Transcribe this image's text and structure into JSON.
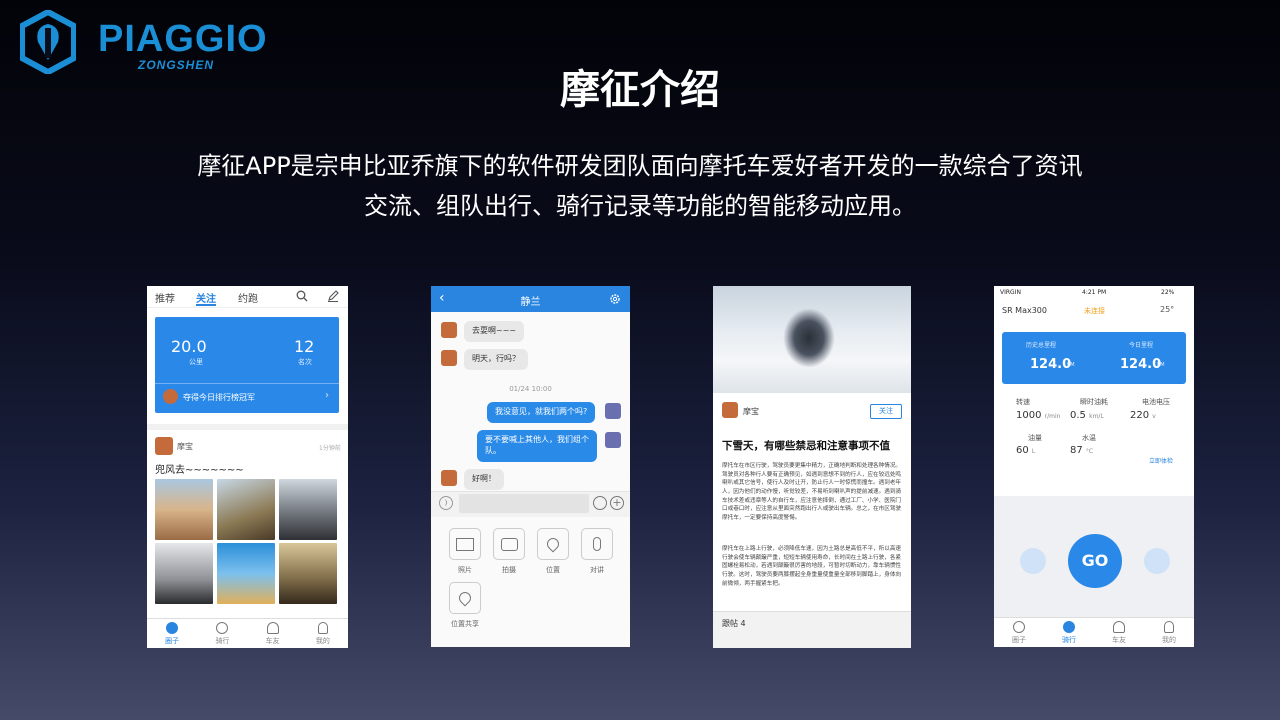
{
  "brand": {
    "name": "PIAGGIO",
    "sub": "ZONGSHEN"
  },
  "slide": {
    "title": "摩征介绍",
    "intro_line1": "摩征APP是宗申比亚乔旗下的软件研发团队面向摩托车爱好者开发的一款综合了资讯",
    "intro_line2": "交流、组队出行、骑行记录等功能的智能移动应用。"
  },
  "colors": {
    "accent": "#2a85e0",
    "brand": "#1b8fd6"
  },
  "p1": {
    "tabs": [
      "推荐",
      "关注",
      "约跑"
    ],
    "card_value_left": "20.0",
    "card_unit_left": "公里",
    "card_value_right": "12",
    "card_unit_right": "名次",
    "card_rank_text": "夺得今日排行榜冠军",
    "post_user": "摩宝",
    "post_time": "1分钟前",
    "post_text": "兜风去~~~~~~~",
    "bottom_tabs": [
      "圈子",
      "骑行",
      "车友",
      "我的"
    ]
  },
  "p2": {
    "title": "静兰",
    "m1": "去耍啊~~~",
    "m2": "明天，行吗？",
    "time": "01/24 10:00",
    "m3": "我没意见，就我们两个吗?",
    "m4": "要不要喊上其他人，我们组个队。",
    "m5": "好啊！",
    "tools": [
      "照片",
      "拍摄",
      "位置",
      "对讲",
      "位置共享"
    ]
  },
  "p3": {
    "user": "摩宝",
    "follow": "关注",
    "headline": "下雪天，有哪些禁忌和注意事项不值",
    "para1": "摩托车在市区行驶，驾驶员要更集中精力，正确地判断和处理各种情况。驾驶员对各种行人要有正确预见，如遇到意想不到的行人，应在较远处鸣喇叭或其它信号，使行人及时让开，防止行人一时惊慌而撞车。遇到老年人，因为他们的动作慢，听觉较差，不易听到喇叭声的提前减速。遇到骑车技术差或违章等人的自行车，应注意他摔倒，通过工厂、小学、医院门口或巷口时，应注意从里面突然跑出行人或驶出车辆。总之，在市区驾驶摩托车，一定要保持高度警惕。",
    "para2": "摩托车在上路上行驶，必须降低车速，因为土路总是高低不平，所以高速行驶会使车辆颠簸严重，短短车辆使用寿命，长时间在土路上行驶，各紧固螺栓易松动，若遇到颠簸很厉害的地段，可暂时切断动力，靠车辆惯性行驶。这时，驾驶员要两膝摆起全身重量使重量全部移到脚踏上，身体向前微倾，两手握紧车把。",
    "footer": "跟帖 4"
  },
  "p4": {
    "carrier": "VIRGIN",
    "time": "4:21 PM",
    "battery": "22%",
    "model": "SR Max300",
    "status": "未连接",
    "temp": "25°",
    "hist_label": "历史总里程",
    "hist_value": "124.0",
    "today_label": "今日里程",
    "today_value": "124.0",
    "unit_km": "KM",
    "speed_label": "转速",
    "speed_value": "1000",
    "speed_unit": "r/min",
    "fuel_label": "瞬时油耗",
    "fuel_value": "0.5",
    "fuel_unit": "km/L",
    "volt_label": "电池电压",
    "volt_value": "220",
    "volt_unit": "v",
    "oil_label": "油量",
    "oil_value": "60",
    "oil_unit": "L",
    "water_label": "水温",
    "water_value": "87",
    "water_unit": "°C",
    "check": "立即体检",
    "go": "GO",
    "bottom_tabs": [
      "圈子",
      "骑行",
      "车友",
      "我的"
    ]
  }
}
